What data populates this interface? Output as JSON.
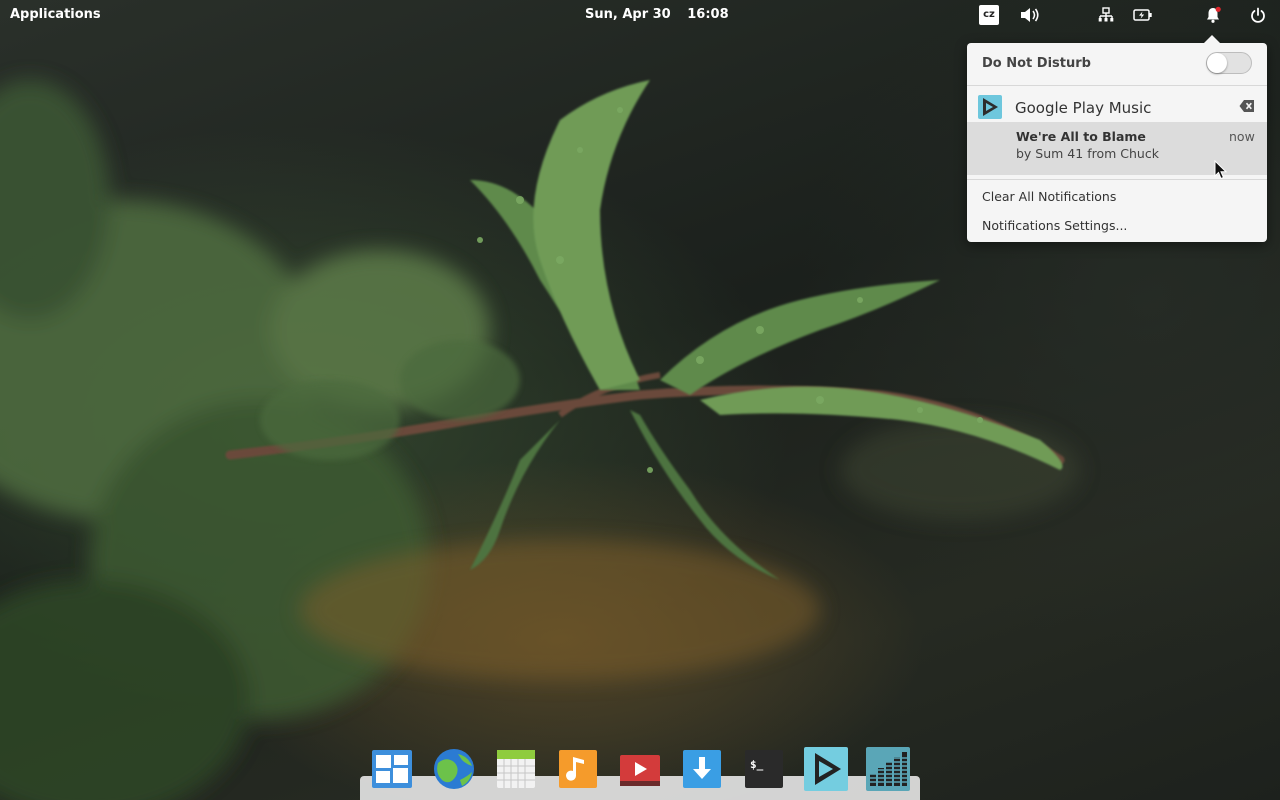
{
  "panel": {
    "applications_label": "Applications",
    "clock": {
      "date": "Sun, Apr 30",
      "time": "16:08"
    },
    "indicators": {
      "keyboard_layout": "cz",
      "icons": [
        "volume-icon",
        "network-icon",
        "battery-icon",
        "notification-bell-icon",
        "power-icon"
      ]
    }
  },
  "notifications_popover": {
    "do_not_disturb_label": "Do Not Disturb",
    "do_not_disturb_on": false,
    "app_group": {
      "app_name": "Google Play Music",
      "notification": {
        "title": "We're All to Blame",
        "body": "by Sum 41 from Chuck",
        "time": "now"
      }
    },
    "clear_all_label": "Clear All Notifications",
    "settings_label": "Notifications Settings..."
  },
  "dock": {
    "items": [
      "multitasking-view-icon",
      "web-browser-icon",
      "calendar-icon",
      "music-icon",
      "videos-icon",
      "appcenter-icon",
      "terminal-icon",
      "google-play-music-icon",
      "equalizer-icon"
    ]
  },
  "colors": {
    "popover_bg": "#f5f5f5",
    "notification_highlight": "#dcdcdc",
    "play_music_accent": "#6ec7dd"
  }
}
